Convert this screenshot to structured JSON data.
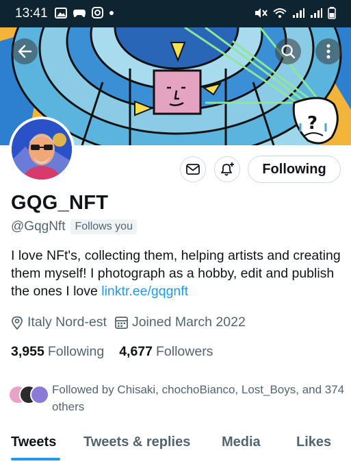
{
  "status_bar": {
    "time": "13:41",
    "icons": [
      "gallery-icon",
      "game-controller-icon",
      "instagram-icon",
      "dot-icon",
      "mute-icon",
      "wifi-icon",
      "signal-icon",
      "signal-icon",
      "battery-icon"
    ]
  },
  "header": {
    "back_icon": "arrow-left-icon",
    "search_icon": "search-icon",
    "more_icon": "more-vertical-icon"
  },
  "actions": {
    "message_icon": "envelope-icon",
    "notify_icon": "bell-plus-icon",
    "following_label": "Following"
  },
  "profile": {
    "display_name": "GQG_NFT",
    "handle": "@GqgNft",
    "follows_you": "Follows you",
    "bio_text": "I love NFt's,  collecting them, helping artists and creating them myself! I photograph as a hobby, edit and publish the ones I love ",
    "bio_link": "linktr.ee/gqgnft",
    "location": "Italy Nord-est",
    "joined": "Joined March 2022"
  },
  "stats": {
    "following_count": "3,955",
    "following_label": "Following",
    "followers_count": "4,677",
    "followers_label": "Followers"
  },
  "followed_by": {
    "text": "Followed by Chisaki, chochoBianco, Lost_Boys, and 374 others"
  },
  "tabs": [
    {
      "label": "Tweets",
      "active": true
    },
    {
      "label": "Tweets & replies",
      "active": false
    },
    {
      "label": "Media",
      "active": false
    },
    {
      "label": "Likes",
      "active": false
    }
  ],
  "colors": {
    "accent": "#1d9bf0",
    "secondary_text": "#536471",
    "primary_text": "#0f1419"
  }
}
